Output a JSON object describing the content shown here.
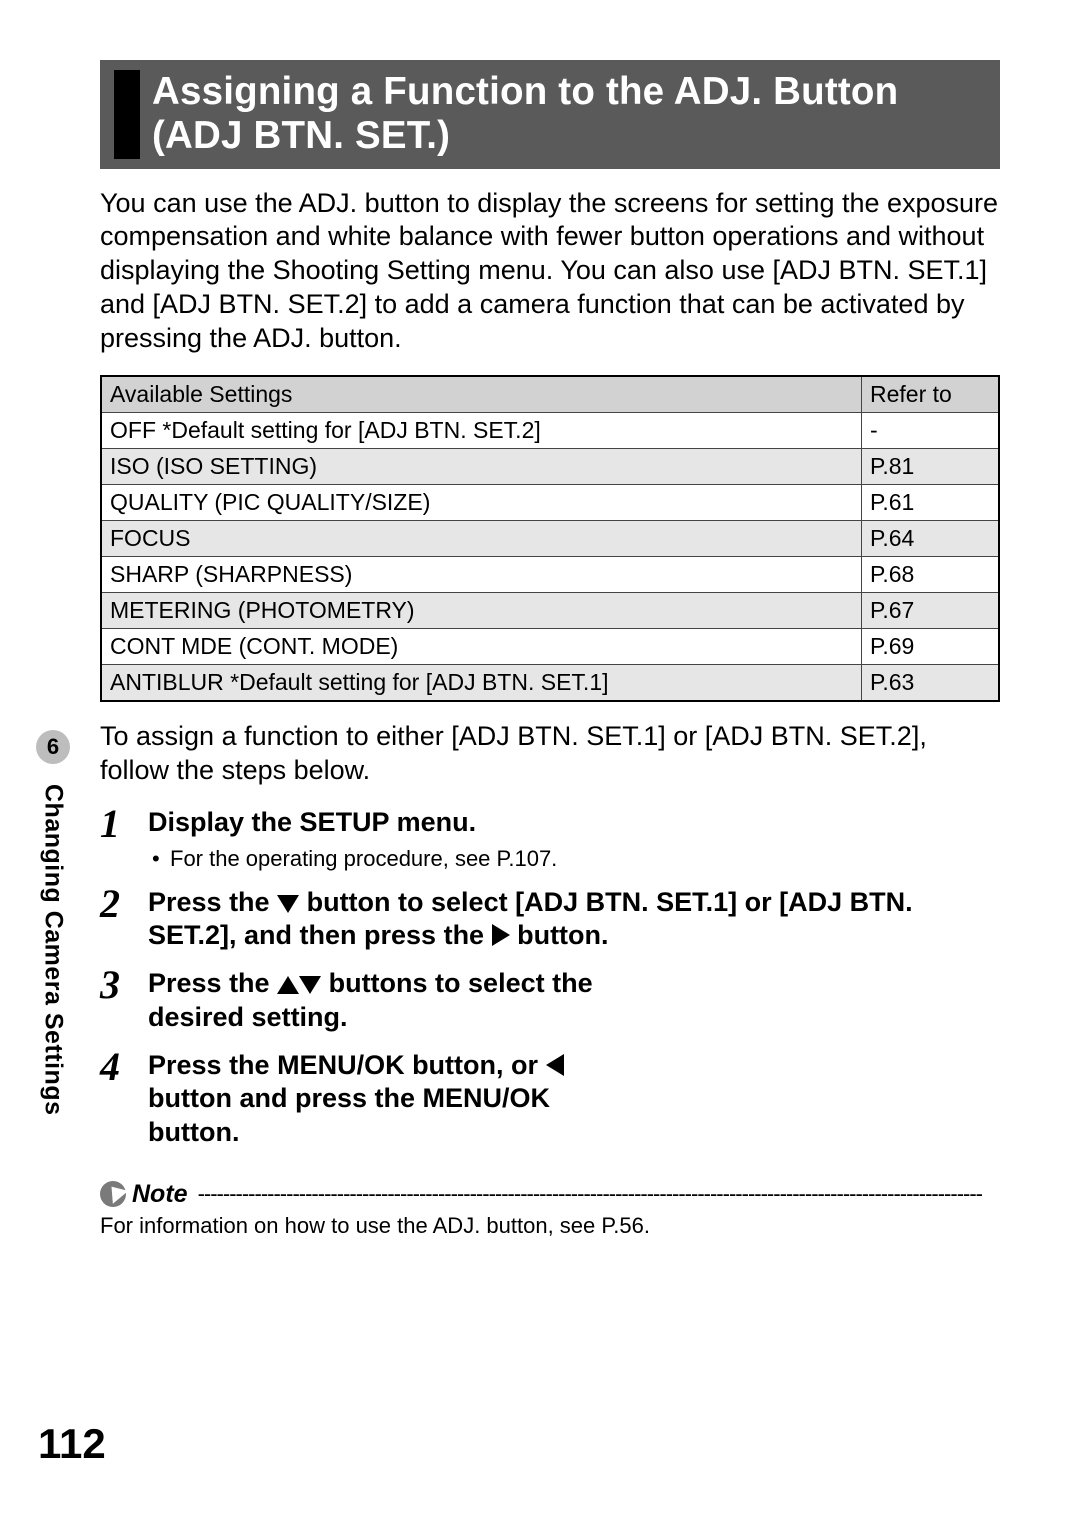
{
  "page_number": "112",
  "side": {
    "chapter": "6",
    "label": "Changing Camera Settings"
  },
  "title": "Assigning a Function to the ADJ. Button (ADJ BTN. SET.)",
  "intro": "You can use the ADJ. button to display the screens for setting the exposure compensation and white balance with fewer button operations and without displaying the Shooting Setting menu. You can also use [ADJ BTN. SET.1] and [ADJ BTN. SET.2] to add a camera function that can be activated by pressing the ADJ. button.",
  "table": {
    "headers": {
      "col1": "Available Settings",
      "col2": "Refer to"
    },
    "rows": [
      {
        "setting": "OFF *Default setting for [ADJ BTN. SET.2]",
        "ref": "-",
        "shade": false
      },
      {
        "setting": "ISO (ISO SETTING)",
        "ref": "P.81",
        "shade": true
      },
      {
        "setting": "QUALITY (PIC QUALITY/SIZE)",
        "ref": "P.61",
        "shade": false
      },
      {
        "setting": "FOCUS",
        "ref": "P.64",
        "shade": true
      },
      {
        "setting": "SHARP (SHARPNESS)",
        "ref": "P.68",
        "shade": false
      },
      {
        "setting": "METERING (PHOTOMETRY)",
        "ref": "P.67",
        "shade": true
      },
      {
        "setting": "CONT MDE (CONT. MODE)",
        "ref": "P.69",
        "shade": false
      },
      {
        "setting": "ANTIBLUR *Default setting for [ADJ BTN. SET.1]",
        "ref": "P.63",
        "shade": true
      }
    ]
  },
  "after_table": "To assign a function to either [ADJ BTN. SET.1] or [ADJ BTN. SET.2], follow the steps below.",
  "steps": {
    "s1": {
      "head": "Display the SETUP menu.",
      "sub": "For the operating procedure, see P.107."
    },
    "s2": {
      "pre": "Press the ",
      "mid": " button to select [ADJ BTN. SET.1] or [ADJ BTN. SET.2], and then press the ",
      "post": " button."
    },
    "s3": {
      "pre": "Press the ",
      "post": " buttons to select the desired setting."
    },
    "s4": {
      "pre": "Press the MENU/OK button, or ",
      "post": " button and press the MENU/OK button."
    }
  },
  "note": {
    "label": "Note",
    "text": "For information on how to use the ADJ. button, see P.56."
  }
}
